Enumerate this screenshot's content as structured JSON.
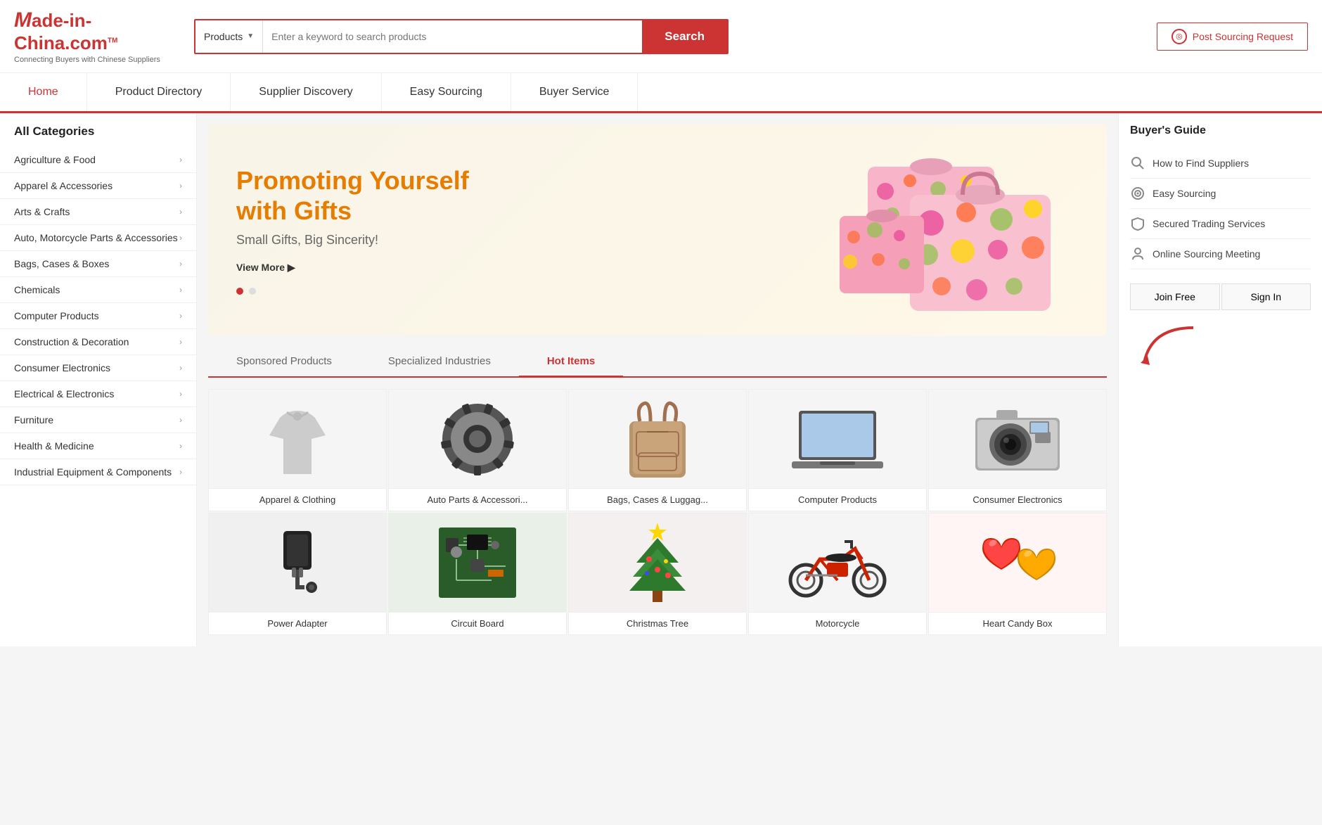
{
  "header": {
    "logo_main": "Made-in-China.com",
    "logo_tm": "TM",
    "logo_subtitle": "Connecting Buyers with Chinese Suppliers",
    "search_category": "Products",
    "search_placeholder": "Enter a keyword to search products",
    "search_btn": "Search",
    "post_sourcing_label": "Post Sourcing Request"
  },
  "nav": {
    "items": [
      {
        "label": "Home",
        "active": true
      },
      {
        "label": "Product Directory",
        "active": false
      },
      {
        "label": "Supplier Discovery",
        "active": false
      },
      {
        "label": "Easy Sourcing",
        "active": false
      },
      {
        "label": "Buyer Service",
        "active": false
      }
    ]
  },
  "sidebar": {
    "title": "All Categories",
    "items": [
      "Agriculture & Food",
      "Apparel & Accessories",
      "Arts & Crafts",
      "Auto, Motorcycle Parts & Accessories",
      "Bags, Cases & Boxes",
      "Chemicals",
      "Computer Products",
      "Construction & Decoration",
      "Consumer Electronics",
      "Electrical & Electronics",
      "Furniture",
      "Health & Medicine",
      "Industrial Equipment & Components"
    ]
  },
  "banner": {
    "heading": "Promoting Yourself with Gifts",
    "subheading": "Small Gifts, Big Sincerity!",
    "link_label": "View More ▶"
  },
  "tabs": {
    "items": [
      {
        "label": "Sponsored Products",
        "active": false
      },
      {
        "label": "Specialized Industries",
        "active": false
      },
      {
        "label": "Hot Items",
        "active": true
      }
    ]
  },
  "products_row1": [
    {
      "label": "Apparel & Clothing",
      "icon": "👕"
    },
    {
      "label": "Auto Parts & Accessori...",
      "icon": "🔧"
    },
    {
      "label": "Bags, Cases & Luggag...",
      "icon": "🎒"
    },
    {
      "label": "Computer Products",
      "icon": "💻"
    },
    {
      "label": "Consumer Electronics",
      "icon": "📷"
    }
  ],
  "products_row2": [
    {
      "label": "Power Adapter",
      "icon": "🔌"
    },
    {
      "label": "Circuit Board",
      "icon": "🔲"
    },
    {
      "label": "Christmas Tree",
      "icon": "🎄"
    },
    {
      "label": "Motorcycle",
      "icon": "🏍️"
    },
    {
      "label": "Heart Candy Box",
      "icon": "🍫"
    }
  ],
  "buyers_guide": {
    "title": "Buyer's Guide",
    "items": [
      {
        "label": "How to Find Suppliers",
        "icon": "search"
      },
      {
        "label": "Easy Sourcing",
        "icon": "target"
      },
      {
        "label": "Secured Trading Services",
        "icon": "shield"
      },
      {
        "label": "Online Sourcing Meeting",
        "icon": "person"
      }
    ],
    "join_btn": "Join Free",
    "signin_btn": "Sign In"
  },
  "colors": {
    "red": "#cc3333",
    "orange": "#e67c00",
    "light_bg": "#f5f5f5"
  }
}
